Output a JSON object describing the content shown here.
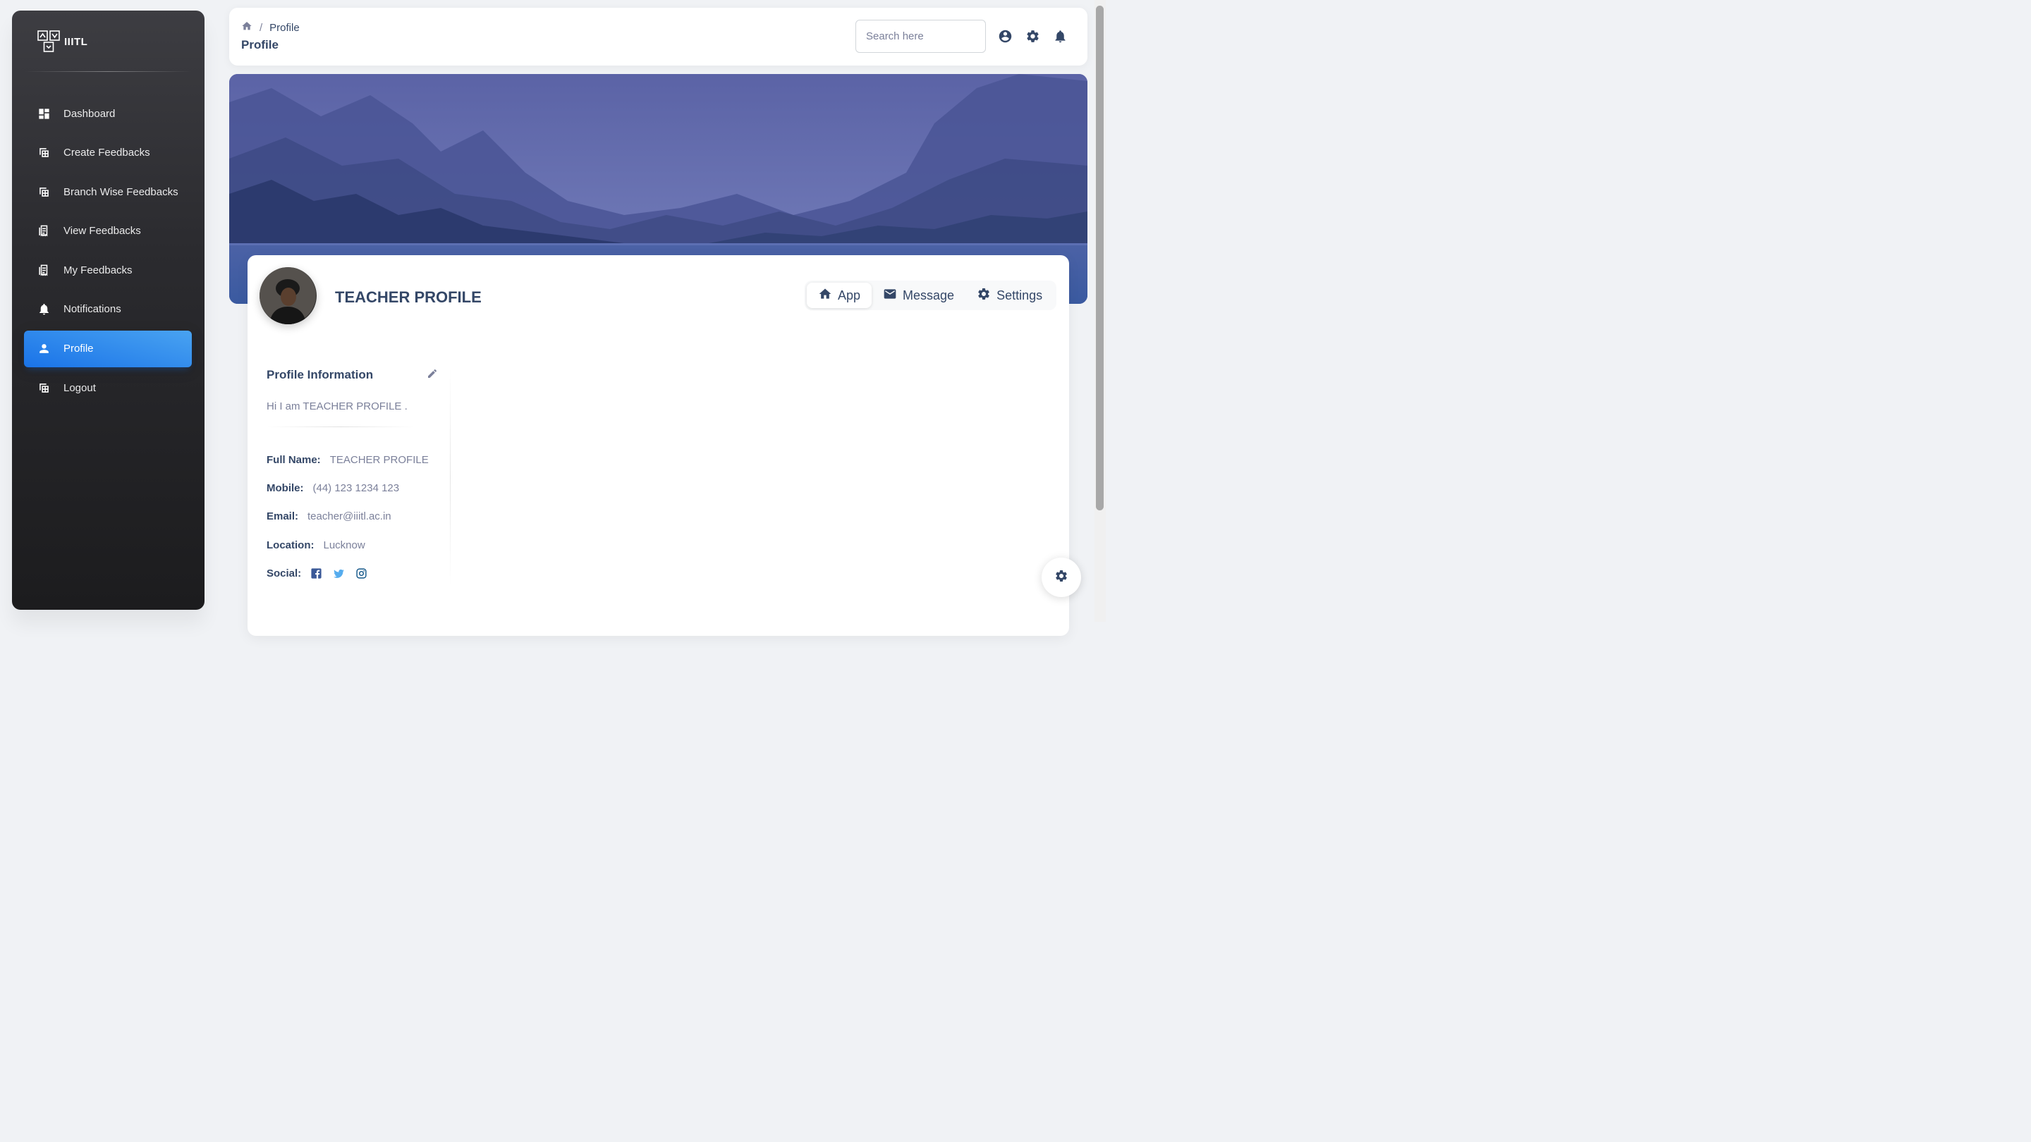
{
  "brand": {
    "name": "IIITL"
  },
  "sidebar": {
    "items": [
      {
        "label": "Dashboard",
        "icon": "dashboard-icon"
      },
      {
        "label": "Create Feedbacks",
        "icon": "table-icon"
      },
      {
        "label": "Branch Wise Feedbacks",
        "icon": "table-icon"
      },
      {
        "label": "View Feedbacks",
        "icon": "receipt-icon"
      },
      {
        "label": "My Feedbacks",
        "icon": "receipt-icon"
      },
      {
        "label": "Notifications",
        "icon": "bell-icon"
      },
      {
        "label": "Profile",
        "icon": "person-icon",
        "active": true
      },
      {
        "label": "Logout",
        "icon": "table-icon"
      }
    ]
  },
  "header": {
    "breadcrumb": {
      "current": "Profile",
      "separator": "/"
    },
    "title": "Profile",
    "search": {
      "placeholder": "Search here",
      "value": ""
    }
  },
  "profile": {
    "name": "TEACHER PROFILE",
    "tabs": [
      {
        "label": "App",
        "icon": "home-icon",
        "active": true
      },
      {
        "label": "Message",
        "icon": "mail-icon"
      },
      {
        "label": "Settings",
        "icon": "gear-icon"
      }
    ],
    "info": {
      "title": "Profile Information",
      "bio": "Hi I am TEACHER PROFILE .",
      "full_name_label": "Full Name:",
      "full_name": "TEACHER PROFILE",
      "mobile_label": "Mobile:",
      "mobile": "(44) 123 1234 123",
      "email_label": "Email:",
      "email": "teacher@iiitl.ac.in",
      "location_label": "Location:",
      "location": "Lucknow",
      "social_label": "Social:",
      "social": [
        "facebook-icon",
        "twitter-icon",
        "instagram-icon"
      ]
    }
  },
  "colors": {
    "accent": "#1A73E8",
    "text": "#344767",
    "muted": "#7b809a",
    "facebook": "#3b5998",
    "twitter": "#55acee",
    "instagram": "#125688"
  }
}
